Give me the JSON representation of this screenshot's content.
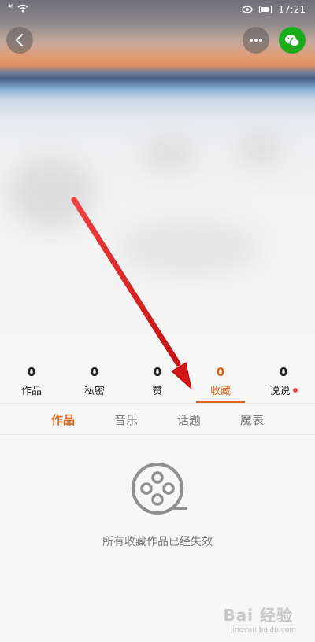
{
  "status_bar": {
    "signal": "⁴⁶",
    "time": "17:21"
  },
  "header": {
    "back_icon": "chevron-left-icon",
    "more_icon": "more-horizontal-icon",
    "share_icon": "wechat-icon",
    "share_color": "#1aad19"
  },
  "stats": [
    {
      "value": "0",
      "label": "作品"
    },
    {
      "value": "0",
      "label": "私密"
    },
    {
      "value": "0",
      "label": "赞"
    },
    {
      "value": "0",
      "label": "收藏"
    },
    {
      "value": "0",
      "label": "说说"
    }
  ],
  "active_stat": "收藏",
  "subtabs": [
    {
      "label": "作品"
    },
    {
      "label": "音乐"
    },
    {
      "label": "话题"
    },
    {
      "label": "魔表"
    }
  ],
  "empty_state": {
    "icon": "film-reel-icon",
    "message": "所有收藏作品已经失效"
  },
  "watermark": {
    "text": "Bai 经验",
    "sub": "jingyan.baidu.com"
  },
  "colors": {
    "accent": "#e0651d",
    "arrow": "#e02020"
  }
}
